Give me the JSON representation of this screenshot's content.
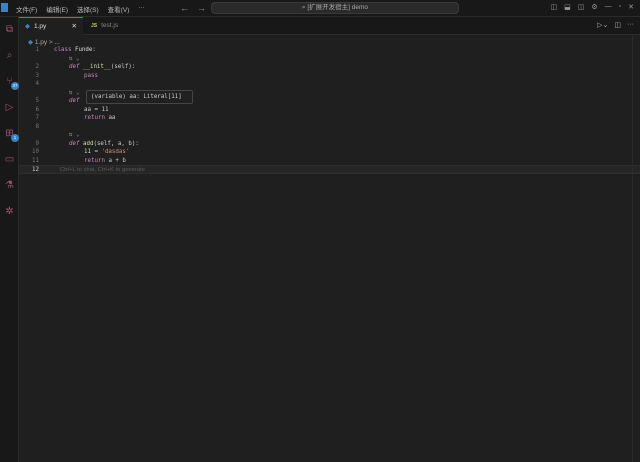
{
  "titlebar": {
    "menus": [
      "文件(F)",
      "编辑(E)",
      "选择(S)",
      "查看(V)",
      "···"
    ],
    "search": "[扩展开发宿主] demo",
    "back": "←",
    "forward": "→"
  },
  "activity": [
    {
      "name": "explorer-icon",
      "glyph": "⧉"
    },
    {
      "name": "search-icon",
      "glyph": "⌕"
    },
    {
      "name": "source-control-icon",
      "glyph": "⑂",
      "badge": "37"
    },
    {
      "name": "run-debug-icon",
      "glyph": "▷"
    },
    {
      "name": "extensions-icon",
      "glyph": "⊞",
      "badge": "1"
    },
    {
      "name": "remote-explorer-icon",
      "glyph": "▭"
    },
    {
      "name": "testing-icon",
      "glyph": "⚗"
    },
    {
      "name": "settings-sync-icon",
      "glyph": "✲"
    }
  ],
  "tabs": [
    {
      "label": "1.py",
      "icon": "◆",
      "close": "✕"
    },
    {
      "label": "test.js",
      "icon": "JS"
    }
  ],
  "breadcrumb": "1.py > ...",
  "code": {
    "lens": "⇆ ⌄",
    "line_numbers": [
      "1",
      "2",
      "3",
      "4",
      "5",
      "6",
      "7",
      "8",
      "9",
      "10",
      "11",
      "12"
    ],
    "lines": {
      "l1a": "class ",
      "l1b": "Funde",
      ":": ":",
      "l2a": "def ",
      "l2b": "__init__",
      "l2c": "(self):",
      "l3": "pass",
      "l5": "def",
      "l6": "aa = 11",
      "l7a": "return ",
      "l7b": "aa",
      "l9a": "def ",
      "l9b": "add",
      "l9c": "(self, a, b):",
      "l10a": "11 = ",
      "l10b": "'dasdas'",
      "l11a": "return ",
      "l11b": "a + b"
    },
    "hint": "Ctrl+L to chat, Ctrl+K to generate"
  },
  "hover": "(variable) aa: Literal[11]"
}
